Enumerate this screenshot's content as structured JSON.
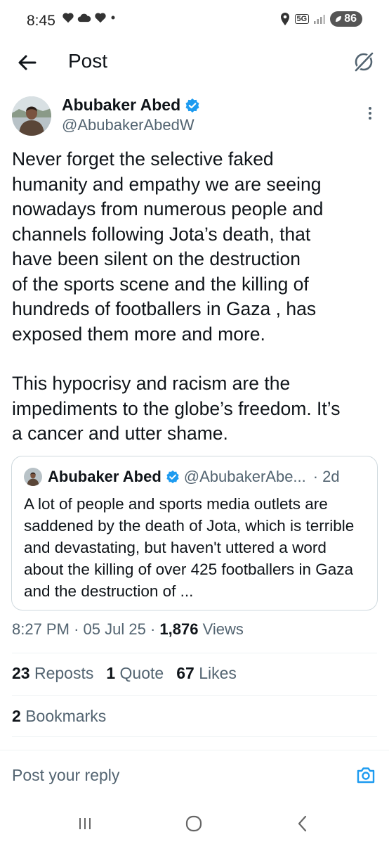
{
  "status_bar": {
    "time": "8:45",
    "battery": "86",
    "network": "5G",
    "notification_icons": [
      "heart-icon",
      "cloud-icon",
      "heart-icon",
      "dot-icon"
    ]
  },
  "header": {
    "title": "Post"
  },
  "post": {
    "author_name": "Abubaker Abed",
    "author_handle": "@AbubakerAbedW",
    "verified": true,
    "paragraphs": [
      "Never forget the selective faked\nhumanity and empathy we are seeing\nnowadays from numerous people and\nchannels following Jota’s death, that\nhave been silent on the destruction\nof the sports scene and the killing of\nhundreds of footballers in Gaza , has\nexposed them more and more.",
      "This hypocrisy and racism are the\nimpediments to the globe’s freedom. It’s\na cancer and utter shame."
    ],
    "time": "8:27 PM",
    "date": "05 Jul 25",
    "views_count": "1,876",
    "views_label": "Views"
  },
  "quoted_post": {
    "author_name": "Abubaker Abed",
    "author_handle": "@AbubakerAbe...",
    "age": "2d",
    "text": "A lot of people and sports media outlets are saddened by the death of Jota, which is terrible and devastating, but haven't uttered a word about the killing of over 425 footballers in Gaza and the destruction of ..."
  },
  "stats": {
    "reposts_count": "23",
    "reposts_label": "Reposts",
    "quotes_count": "1",
    "quotes_label": "Quote",
    "likes_count": "67",
    "likes_label": "Likes",
    "bookmarks_count": "2",
    "bookmarks_label": "Bookmarks"
  },
  "reply": {
    "placeholder": "Post your reply"
  },
  "colors": {
    "accent": "#1d9bf0",
    "text_primary": "#0f1419",
    "text_secondary": "#536471",
    "border": "#cfd9de"
  }
}
